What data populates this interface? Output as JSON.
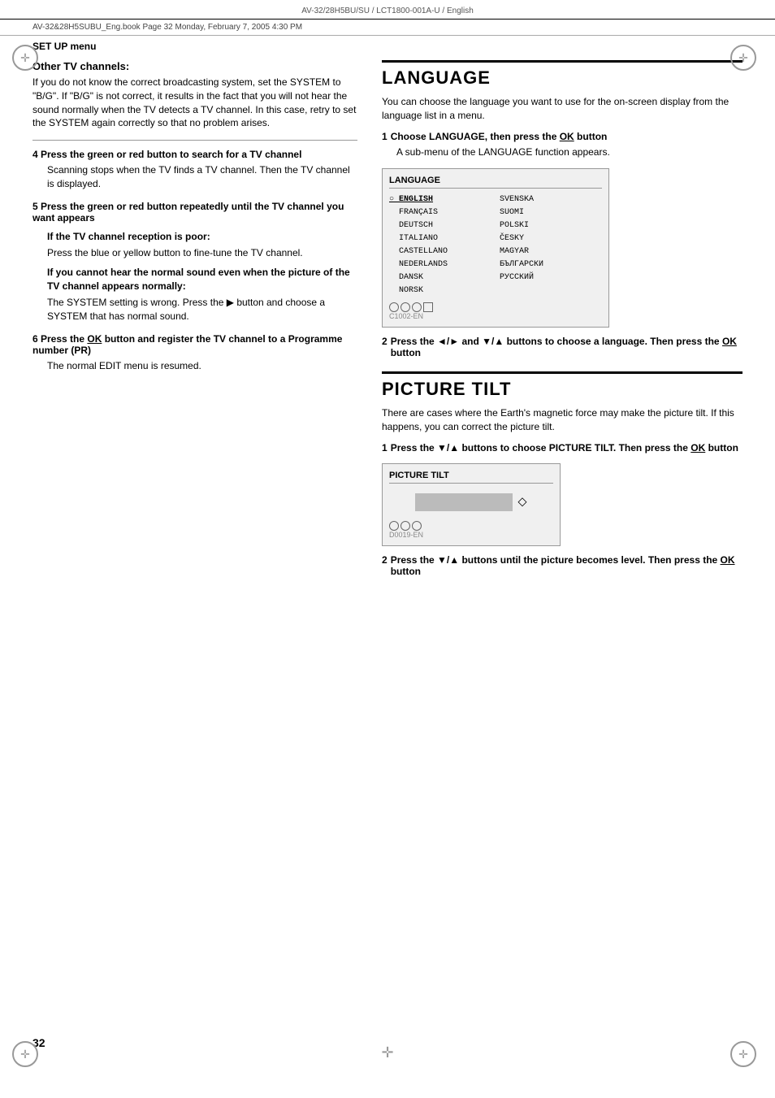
{
  "header": {
    "doc_ref": "AV-32/28H5BU/SU / LCT1800-001A-U / English",
    "file_info": "AV-32&28H5SUBU_Eng.book  Page 32  Monday, February 7, 2005  4:30 PM"
  },
  "section_label": "SET UP menu",
  "left_column": {
    "other_tv_channels": {
      "title": "Other TV channels:",
      "body": "If you do not know the correct broadcasting system, set the SYSTEM to \"B/G\". If \"B/G\" is not correct, it results in the fact that you will not hear the sound normally when the TV detects a TV channel. In this case, retry to set the SYSTEM again correctly so that no problem arises."
    },
    "step4": {
      "heading": "4  Press the green or red button to search for a TV channel",
      "body": "Scanning stops when the TV finds a TV channel. Then the TV channel is displayed."
    },
    "step5": {
      "heading": "5  Press the green or red button repeatedly until the TV channel you want appears",
      "sub1_heading": "If the TV channel reception is poor:",
      "sub1_body": "Press the blue or yellow button to fine-tune the TV channel.",
      "sub2_heading": "If you cannot hear the normal sound even when the picture of the TV channel appears normally:",
      "sub2_body": "The SYSTEM setting is wrong. Press the ▶ button and choose a SYSTEM that has normal sound."
    },
    "step6": {
      "heading": "6  Press the OK button and register the TV channel to a Programme number (PR)",
      "body": "The normal EDIT menu is resumed."
    }
  },
  "right_column": {
    "language": {
      "heading": "LANGUAGE",
      "intro": "You can choose the language you want to use for the on-screen display from the language list in a menu.",
      "step1": {
        "number": "1",
        "heading": "Choose LANGUAGE, then press the OK button",
        "body": "A sub-menu of the LANGUAGE function appears."
      },
      "menu_box": {
        "title": "LANGUAGE",
        "left_items": [
          "ENGLISH",
          "FRANÇAIS",
          "DEUTSCH",
          "ITALIANO",
          "CASTELLANO",
          "NEDERLANDS",
          "DANSK",
          "NORSK"
        ],
        "right_items": [
          "SVENSKA",
          "SUOMI",
          "POLSKI",
          "ČESKY",
          "MAGYAR",
          "БЪЛГАРСКИ",
          "РУССКИЙ"
        ],
        "code": "C1002-EN"
      },
      "step2": {
        "number": "2",
        "heading": "Press the ◄/► and ▼/▲ buttons to choose a language. Then press the OK button"
      }
    },
    "picture_tilt": {
      "heading": "PICTURE TILT",
      "intro": "There are cases where the Earth's magnetic force may make the picture tilt. If this happens, you can correct the picture tilt.",
      "step1": {
        "number": "1",
        "heading": "Press the ▼/▲ buttons to choose PICTURE TILT. Then press the OK button"
      },
      "menu_box": {
        "title": "PICTURE TILT",
        "code": "D0019-EN"
      },
      "step2": {
        "number": "2",
        "heading": "Press the ▼/▲ buttons until the picture becomes level. Then press the OK button"
      }
    }
  },
  "page_number": "32"
}
